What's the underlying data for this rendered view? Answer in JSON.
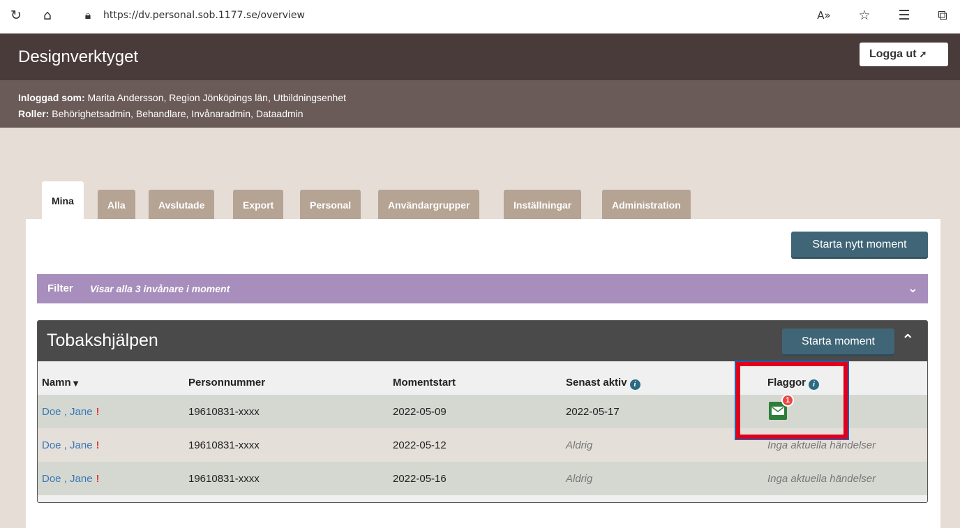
{
  "browser": {
    "url": "https://dv.personal.sob.1177.se/overview"
  },
  "app": {
    "title": "Designverktyget",
    "logout_label": "Logga ut"
  },
  "user": {
    "logged_in_label": "Inloggad som:",
    "logged_in_value": " Marita Andersson, Region Jönköpings län, Utbildningsenhet",
    "roles_label": "Roller:",
    "roles_value": " Behörighetsadmin, Behandlare, Invånaradmin, Dataadmin"
  },
  "tabs": [
    {
      "label": "Mina",
      "active": true
    },
    {
      "label": "Alla"
    },
    {
      "label": "Avslutade"
    },
    {
      "label": "Export"
    },
    {
      "label": "Personal"
    },
    {
      "label": "Användargrupper"
    },
    {
      "label": "Inställningar"
    },
    {
      "label": "Administration"
    }
  ],
  "actions": {
    "new_moment": "Starta nytt moment"
  },
  "filter": {
    "label": "Filter",
    "text": "Visar alla 3 invånare i moment"
  },
  "section": {
    "title": "Tobakshjälpen",
    "start_label": "Starta moment",
    "columns": [
      "Namn",
      "Personnummer",
      "Momentstart",
      "Senast aktiv",
      "Flaggor"
    ],
    "rows": [
      {
        "name": "Doe , Jane",
        "alert": "!",
        "pnr": "19610831-xxxx",
        "start": "2022-05-09",
        "last": "2022-05-17",
        "flags": "",
        "badge": "1"
      },
      {
        "name": "Doe , Jane",
        "alert": "!",
        "pnr": "19610831-xxxx",
        "start": "2022-05-12",
        "last": "Aldrig",
        "flags": "Inga aktuella händelser"
      },
      {
        "name": "Doe , Jane",
        "alert": "!",
        "pnr": "19610831-xxxx",
        "start": "2022-05-16",
        "last": "Aldrig",
        "flags": "Inga aktuella händelser"
      }
    ]
  },
  "colors": {
    "header": "#4a3b3b",
    "userbar": "#6b5b58",
    "tab": "#b5a393",
    "filter": "#a78ebc",
    "button": "#3f6577",
    "highlight": "#e0001b"
  }
}
